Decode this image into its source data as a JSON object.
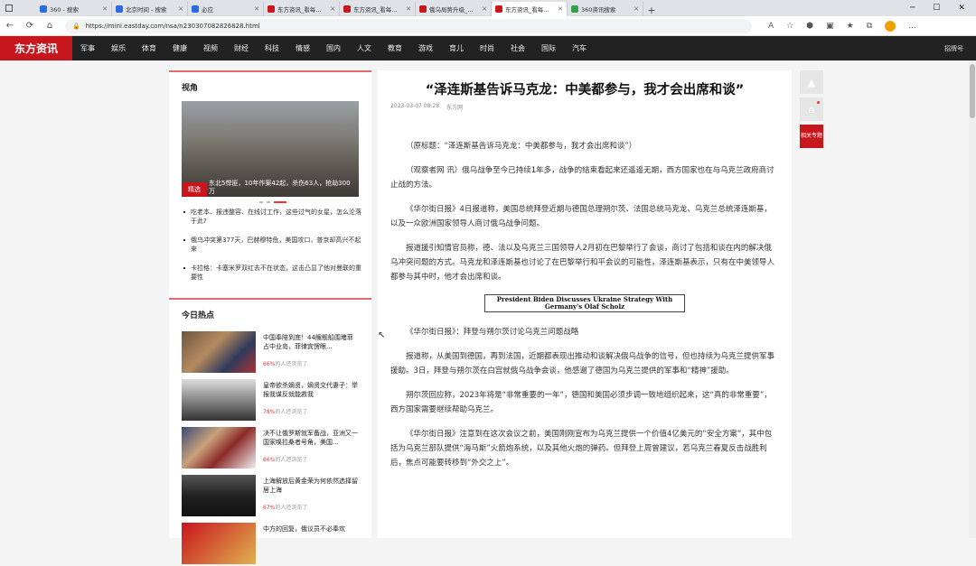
{
  "browser": {
    "tabs": [
      {
        "title": "360 - 搜索",
        "color": "#2b6de0",
        "active": false
      },
      {
        "title": "北京时间 - 搜索",
        "color": "#2b6de0",
        "active": false
      },
      {
        "title": "必应",
        "color": "#2b6de0",
        "active": false
      },
      {
        "title": "东方资讯_看每新热搜消息",
        "color": "#c8161d",
        "active": false
      },
      {
        "title": "东方资讯_看每新热搜消息",
        "color": "#c8161d",
        "active": false
      },
      {
        "title": "俄乌局势升级_东方专题",
        "color": "#c8161d",
        "active": false
      },
      {
        "title": "东方资讯_看每新热搜消息",
        "color": "#c8161d",
        "active": true
      },
      {
        "title": "360资讯搜索",
        "color": "#2fa14b",
        "active": false
      }
    ],
    "url": "https://mini.eastday.com/nsa/n230307082826828.html"
  },
  "site": {
    "logo": "东方资讯",
    "nav": [
      "军事",
      "娱乐",
      "体育",
      "健康",
      "视频",
      "财经",
      "科技",
      "情感",
      "国内",
      "人文",
      "教育",
      "游戏",
      "育儿",
      "时尚",
      "社会",
      "国际",
      "汽车"
    ],
    "right_link": "招牌号"
  },
  "left": {
    "section1_title": "视角",
    "hero_tag": "精选",
    "hero_caption": "东北5悍匪，10年作案42起，杀伤63人，抢劫300万",
    "bullets": [
      "吃老本、报违整容、在线讨工作，这些过气的女星，怎么沦落于此?",
      "俄乌冲突第377天，巴赫穆特危，美国攻口，普京却高兴不起来",
      "卡拉格：卡塞米罗双红去不在状态，这击凸显了他对曼联的重要性"
    ],
    "section2_title": "今日热点",
    "hot": [
      {
        "title": "中国奉陪到底！44艘舰船围堵菲占中业岛，菲律宾愣眼...",
        "pct": "66%",
        "suffix": "的人还浏览了",
        "thumb": "linear-gradient(135deg,#6d5542 0%,#b58b5e 40%,#2f3a5c 70%,#a33 100%)"
      },
      {
        "title": "皇帝欲杀嫡贤，嫡贤交代妻子：举报我谋反就能救我",
        "pct": "78%",
        "suffix": "的人还浏览了",
        "thumb": "linear-gradient(180deg,#ddd 0%,#888 50%,#333 100%)"
      },
      {
        "title": "决不让俄罗斯就军备战，亚洲又一国家唤拉桑者号角，美国...",
        "pct": "66%",
        "suffix": "的人还浏览了",
        "thumb": "linear-gradient(135deg,#3b4a7a 0%,#c8a27a 35%,#8b2a2a 60%,#f2f2f2 100%)"
      },
      {
        "title": "上海解放后黄金荣为何依然选择留居上海",
        "pct": "67%",
        "suffix": "的人还浏览了",
        "thumb": "linear-gradient(180deg,#555 0%,#222 50%,#111 100%)"
      },
      {
        "title": "中方的回复，俄议员不必奉欢",
        "pct": "",
        "suffix": "",
        "thumb": "linear-gradient(135deg,#c8161d 0%,#e0b050 100%)"
      }
    ]
  },
  "article": {
    "title": "“泽连斯基告诉马克龙：中美都参与，我才会出席和谈”",
    "date": "2023-03-07 08:28",
    "source": "东方网",
    "paragraphs": [
      "（原标题：“泽连斯基告诉马克龙：中美都参与，我才会出席和谈”）",
      "（观察者网 讯）俄乌战争至今已持续1年多，战争的结束看起来还遥遥无期，西方国家也在与乌克兰政府商讨止战的方法。",
      "《华尔街日报》4日报道称，美国总统拜登近期与德国总理朔尔茨、法国总统马克龙、乌克兰总统泽连斯基，以及一众欧洲国家领导人商讨俄乌战争问题。",
      "报道援引知情官员称，德、法以及乌克兰三国领导人2月初在巴黎举行了会谈，商讨了包括和谈在内的解决俄乌冲突问题的方式。马克龙和泽连斯基也讨论了在巴黎举行和平会议的可能性，泽连斯基表示，只有在中美领导人都参与其中时，他才会出席和谈。"
    ],
    "image_caption": "President Biden Discusses Ukraine Strategy With Germany's Olaf Scholz",
    "paragraphs2": [
      "《华尔街日报》：拜登与朔尔茨讨论乌克兰问题战略",
      "报道称，从美国到德国，再到法国，近期都表现出推动和谈解决俄乌战争的信号，但也持续为乌克兰提供军事援助。3日，拜登与朔尔茨在白宫就俄乌战争会谈，他感谢了德国为乌克兰提供的军事和“精神”援助。",
      "朔尔茨回应称，2023年将是“非常重要的一年”，德国和美国必须步调一致地组织起来，这“真的非常重要”，西方国家需要继续帮助乌克兰。",
      "《华尔街日报》注意到在这次会议之前，美国刚刚宣布为乌克兰提供一个价值4亿美元的“安全方案”，其中包括为乌克兰部队提供“海马斯”火箭炮系统，以及其他火炮的弹药。但拜登上周曾建议，若乌克兰春夏反击战胜利后，焦点可能要转移到“外交之上”。"
    ]
  },
  "sidebar": {
    "related": "相关专题"
  }
}
